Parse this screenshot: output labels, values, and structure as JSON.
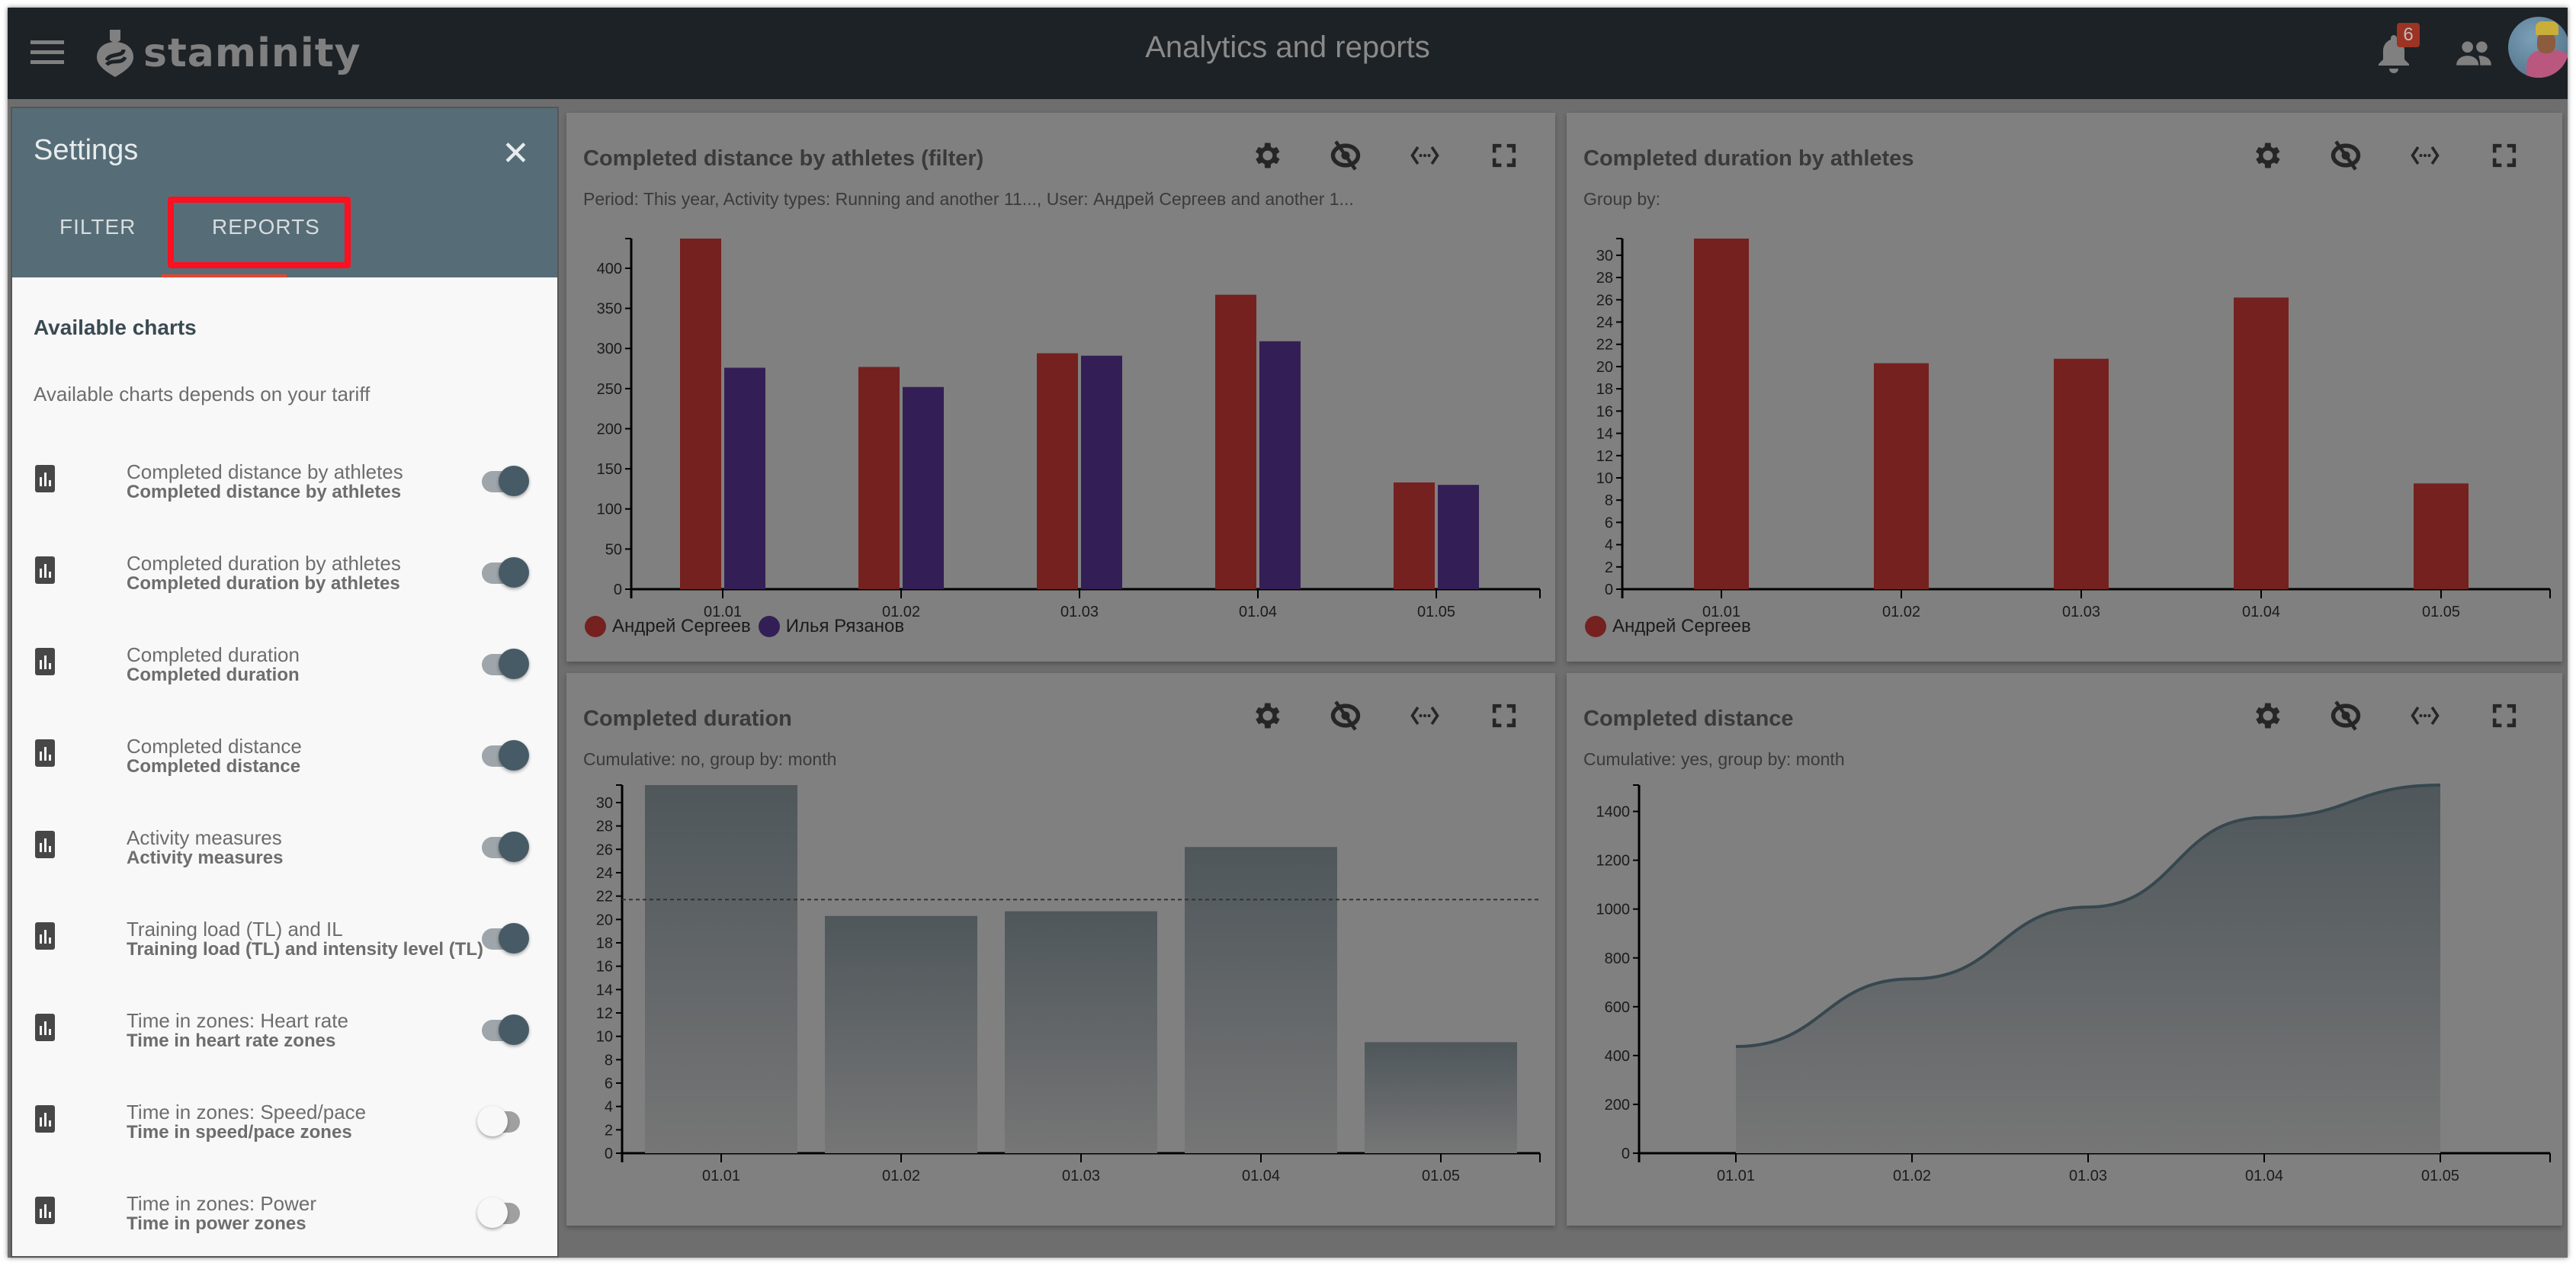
{
  "app": {
    "brand": "staminity",
    "page_title": "Analytics and reports",
    "notifications_count": "6",
    "icons": {
      "menu": "menu-icon",
      "bell": "bell-icon",
      "people": "people-icon",
      "avatar": "avatar"
    }
  },
  "settings": {
    "title": "Settings",
    "close_icon": "close-icon",
    "tabs": [
      {
        "label": "FILTER",
        "active": false
      },
      {
        "label": "REPORTS",
        "active": true
      }
    ],
    "section_title": "Available charts",
    "note": "Available charts depends on your tariff",
    "items": [
      {
        "title": "Completed distance by athletes",
        "subtitle": "Completed distance by athletes",
        "enabled": true
      },
      {
        "title": "Completed duration by athletes",
        "subtitle": "Completed duration by athletes",
        "enabled": true
      },
      {
        "title": "Completed duration",
        "subtitle": "Completed duration",
        "enabled": true
      },
      {
        "title": "Completed distance",
        "subtitle": "Completed distance",
        "enabled": true
      },
      {
        "title": "Activity measures",
        "subtitle": "Activity measures",
        "enabled": true
      },
      {
        "title": "Training load (TL) and IL",
        "subtitle": "Training load (TL) and intensity level (TL)",
        "enabled": true
      },
      {
        "title": "Time in zones: Heart rate",
        "subtitle": "Time in heart rate zones",
        "enabled": true
      },
      {
        "title": "Time in zones: Speed/pace",
        "subtitle": "Time in speed/pace zones",
        "enabled": false
      },
      {
        "title": "Time in zones: Power",
        "subtitle": "Time in power zones",
        "enabled": false
      }
    ]
  },
  "card_tools": [
    "gear-icon",
    "eye-off-icon",
    "code-icon",
    "fullscreen-icon"
  ],
  "colors": {
    "series_a": "#75211f",
    "series_b": "#331f55",
    "bar_gray_top": "#4f575b",
    "bar_gray_bottom": "#767676",
    "line": "#37474f"
  },
  "chart_data": [
    {
      "type": "bar",
      "title": "Completed distance by athletes  (filter)",
      "subtitle": "Period: This year, Activity types: Running and another 11..., User: Андрей Сергеев and another 1...",
      "categories": [
        "01.01",
        "01.02",
        "01.03",
        "01.04",
        "01.05"
      ],
      "series": [
        {
          "name": "Андрей Сергеев",
          "values": [
            437,
            277,
            294,
            367,
            133
          ]
        },
        {
          "name": "Илья Рязанов",
          "values": [
            276,
            252,
            291,
            309,
            130
          ]
        }
      ],
      "yticks": [
        0,
        50,
        100,
        150,
        200,
        250,
        300,
        350,
        400
      ],
      "ylim": [
        0,
        437
      ],
      "legend": "bottom-left"
    },
    {
      "type": "bar",
      "title": "Completed duration by athletes",
      "subtitle": "Group by:",
      "categories": [
        "01.01",
        "01.02",
        "01.03",
        "01.04",
        "01.05"
      ],
      "series": [
        {
          "name": "Андрей Сергеев",
          "values": [
            31.5,
            20.3,
            20.7,
            26.2,
            9.5
          ]
        }
      ],
      "yticks": [
        0,
        2,
        4,
        6,
        8,
        10,
        12,
        14,
        16,
        18,
        20,
        22,
        24,
        26,
        28,
        30
      ],
      "ylim": [
        0,
        31.5
      ],
      "legend": "bottom-left"
    },
    {
      "type": "bar",
      "title": "Completed duration",
      "subtitle": "Cumulative: no, group by: month",
      "categories": [
        "01.01",
        "01.02",
        "01.03",
        "01.04",
        "01.05"
      ],
      "series": [
        {
          "name": "Completed duration",
          "values": [
            31.5,
            20.3,
            20.7,
            26.2,
            9.5
          ]
        }
      ],
      "average": 21.7,
      "yticks": [
        0,
        2,
        4,
        6,
        8,
        10,
        12,
        14,
        16,
        18,
        20,
        22,
        24,
        26,
        28,
        30
      ],
      "ylim": [
        0,
        31.5
      ]
    },
    {
      "type": "area",
      "title": "Completed distance",
      "subtitle": "Cumulative: yes, group by: month",
      "categories": [
        "01.01",
        "01.02",
        "01.03",
        "01.04",
        "01.05"
      ],
      "series": [
        {
          "name": "Completed distance",
          "values": [
            437,
            714,
            1008,
            1375,
            1508
          ]
        }
      ],
      "yticks": [
        0,
        200,
        400,
        600,
        800,
        1000,
        1200,
        1400
      ],
      "ylim": [
        0,
        1508
      ]
    }
  ]
}
